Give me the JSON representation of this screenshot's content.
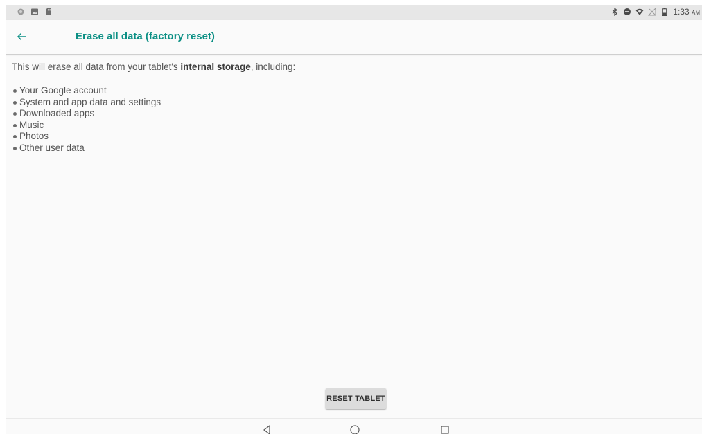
{
  "status_bar": {
    "left_icons": [
      "sync-circle-icon",
      "image-icon",
      "sd-card-icon"
    ],
    "right_icons": [
      "bluetooth-icon",
      "do-not-disturb-icon",
      "wifi-icon",
      "no-signal-icon",
      "battery-icon"
    ],
    "time": "1:33",
    "ampm": "AM"
  },
  "app_bar": {
    "back_icon": "arrow-left-icon",
    "title": "Erase all data (factory reset)"
  },
  "content": {
    "intro_prefix": "This will erase all data from your tablet's ",
    "intro_bold": "internal storage",
    "intro_suffix": ", including:",
    "items": [
      "Your Google account",
      "System and app data and settings",
      "Downloaded apps",
      "Music",
      "Photos",
      "Other user data"
    ]
  },
  "actions": {
    "reset_label": "RESET TABLET"
  },
  "nav_bar": {
    "buttons": [
      "back-triangle-icon",
      "home-circle-icon",
      "recents-square-icon"
    ]
  },
  "colors": {
    "accent": "#0b8f84",
    "background": "#fafafa",
    "status_bar": "#e7e7e7",
    "button": "#dcdcdc",
    "text": "#545454"
  }
}
